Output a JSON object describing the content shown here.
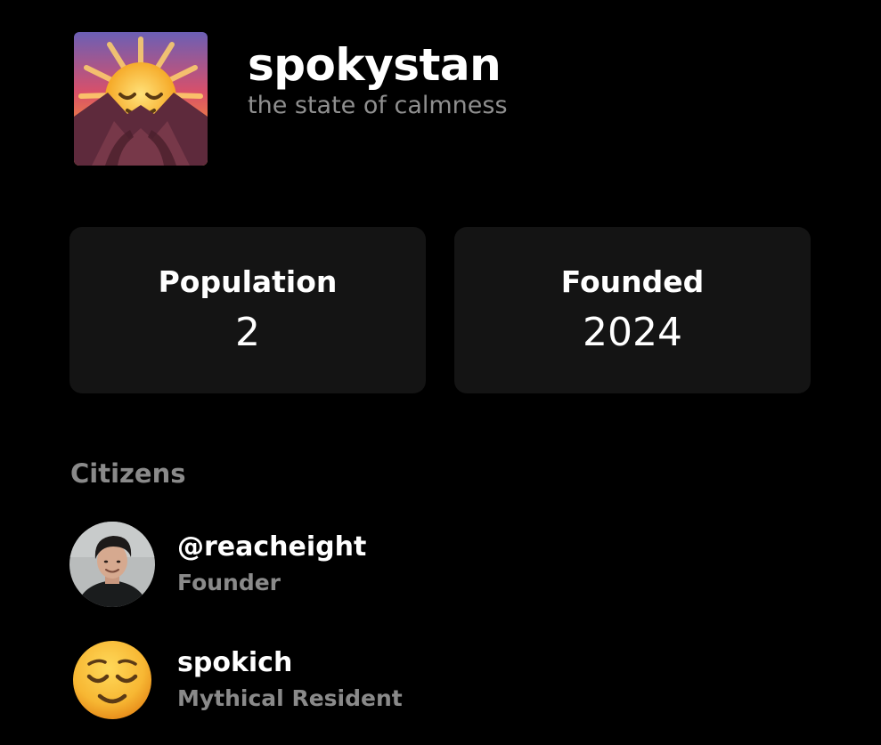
{
  "state": {
    "logo_icon": "sunrise-relieved-face-emoji",
    "name": "spokystan",
    "tagline": "the state of calmness"
  },
  "stats": [
    {
      "label": "Population",
      "value": "2"
    },
    {
      "label": "Founded",
      "value": "2024"
    }
  ],
  "citizens_section": {
    "title": "Citizens",
    "items": [
      {
        "name": "@reacheight",
        "role": "Founder",
        "avatar": "profile-photo"
      },
      {
        "name": "spokich",
        "role": "Mythical Resident",
        "avatar": "relieved-face-emoji"
      }
    ]
  },
  "colors": {
    "background": "#000000",
    "card": "#141414",
    "muted_text": "#8a8a8a"
  }
}
